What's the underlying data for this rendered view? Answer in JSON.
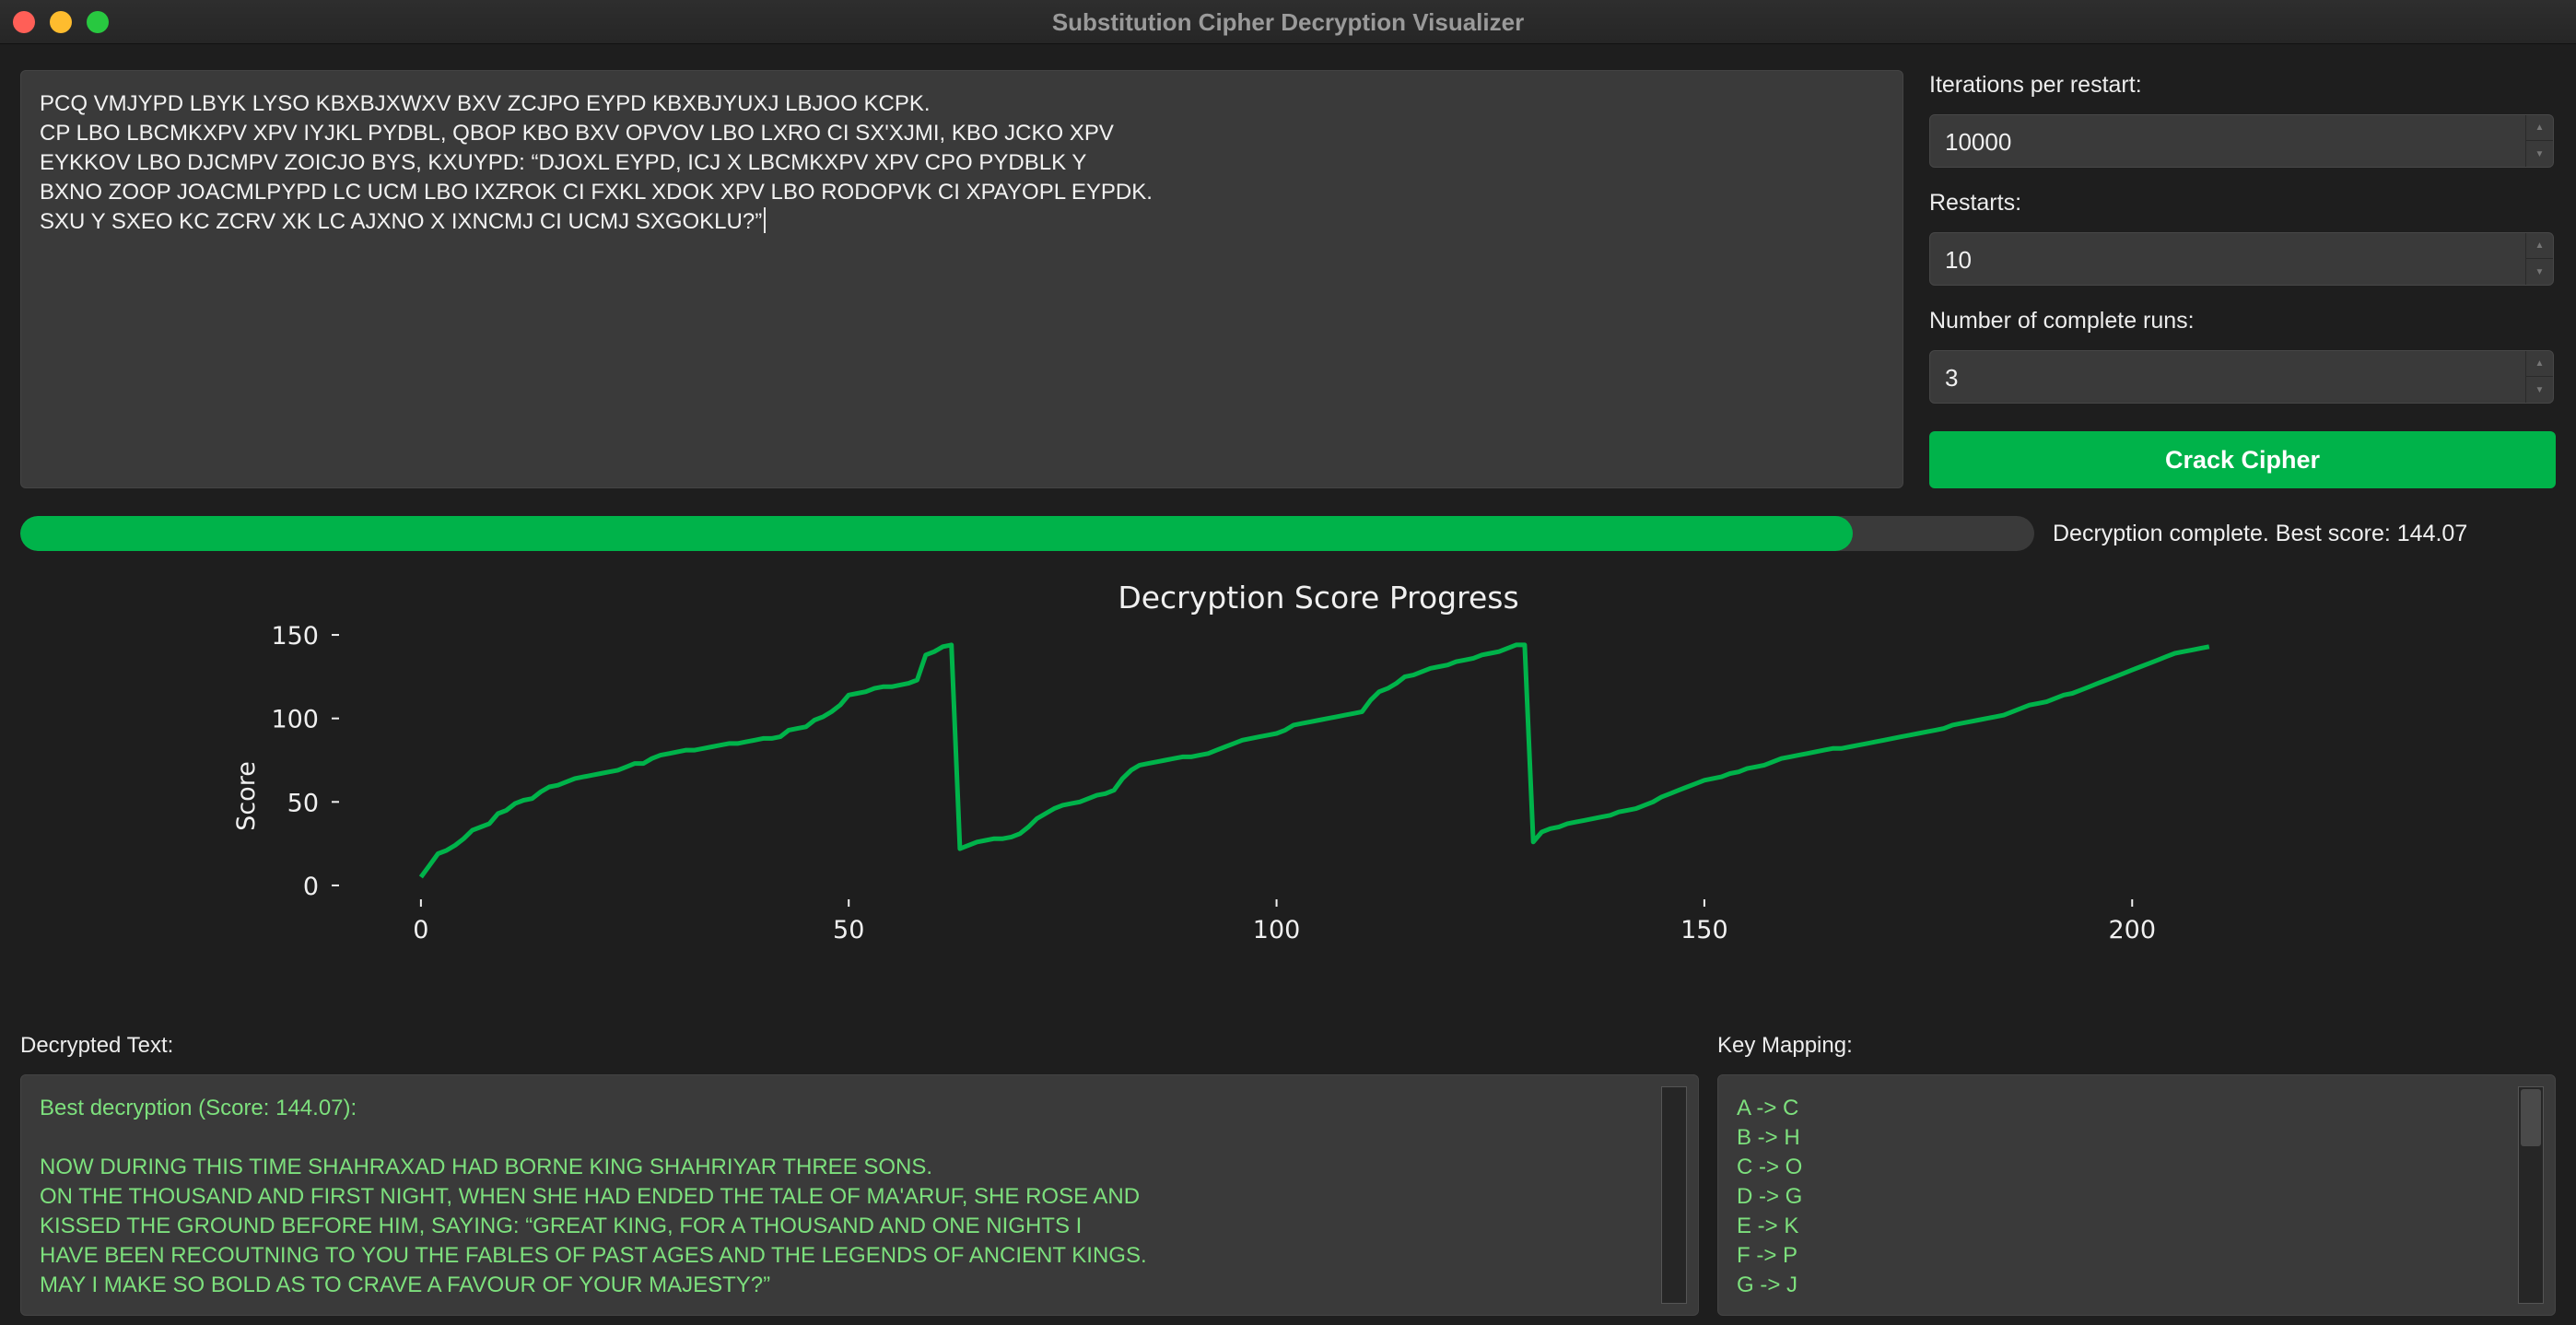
{
  "window": {
    "title": "Substitution Cipher Decryption Visualizer"
  },
  "cipher_input": {
    "lines": [
      "PCQ VMJYPD LBYK LYSO KBXBJXWXV BXV ZCJPO EYPD KBXBJYUXJ LBJOO KCPK.",
      "CP LBO LBCMKXPV XPV IYJKL PYDBL, QBOP KBO BXV OPVOV LBO LXRO CI SX'XJMI, KBO JCKO XPV",
      "EYKKOV LBO DJCMPV ZOICJO BYS, KXUYPD: “DJOXL EYPD, ICJ X LBCMKXPV XPV CPO PYDBLK Y",
      "BXNO ZOOP JOACMLPYPD LC UCM LBO IXZROK CI FXKL XDOK XPV LBO RODOPVK CI XPAYOPL EYPDK.",
      "SXU Y SXEO KC ZCRV XK LC AJXNO X IXNCMJ CI UCMJ SXGOKLU?”"
    ]
  },
  "settings": {
    "iterations_label": "Iterations per restart:",
    "iterations_value": "10000",
    "restarts_label": "Restarts:",
    "restarts_value": "10",
    "runs_label": "Number of complete runs:",
    "runs_value": "3",
    "crack_button": "Crack Cipher"
  },
  "progress": {
    "fraction": 0.91,
    "status": "Decryption complete. Best score: 144.07"
  },
  "colors": {
    "accent": "#00b34a",
    "decrypted_text": "#7de07d"
  },
  "chart_data": {
    "type": "line",
    "title": "Decryption Score Progress",
    "xlabel": "",
    "ylabel": "Score",
    "xlim": [
      -10,
      220
    ],
    "ylim": [
      -5,
      155
    ],
    "x_ticks": [
      0,
      50,
      100,
      150,
      200
    ],
    "y_ticks": [
      0,
      50,
      100,
      150
    ],
    "grid": false,
    "series": [
      {
        "color": "#00b34a",
        "points": [
          [
            0,
            5
          ],
          [
            1,
            12
          ],
          [
            2,
            19
          ],
          [
            3,
            21
          ],
          [
            4,
            24
          ],
          [
            5,
            28
          ],
          [
            6,
            33
          ],
          [
            7,
            35
          ],
          [
            8,
            37
          ],
          [
            9,
            43
          ],
          [
            10,
            45
          ],
          [
            11,
            49
          ],
          [
            12,
            51
          ],
          [
            13,
            52
          ],
          [
            14,
            56
          ],
          [
            15,
            59
          ],
          [
            16,
            60
          ],
          [
            17,
            62
          ],
          [
            18,
            64
          ],
          [
            19,
            65
          ],
          [
            20,
            66
          ],
          [
            21,
            67
          ],
          [
            22,
            68
          ],
          [
            23,
            69
          ],
          [
            24,
            71
          ],
          [
            25,
            73
          ],
          [
            26,
            73
          ],
          [
            27,
            76
          ],
          [
            28,
            78
          ],
          [
            29,
            79
          ],
          [
            30,
            80
          ],
          [
            31,
            81
          ],
          [
            32,
            81
          ],
          [
            33,
            82
          ],
          [
            34,
            83
          ],
          [
            35,
            84
          ],
          [
            36,
            85
          ],
          [
            37,
            85
          ],
          [
            38,
            86
          ],
          [
            39,
            87
          ],
          [
            40,
            88
          ],
          [
            41,
            88
          ],
          [
            42,
            89
          ],
          [
            43,
            93
          ],
          [
            44,
            94
          ],
          [
            45,
            95
          ],
          [
            46,
            99
          ],
          [
            47,
            101
          ],
          [
            48,
            104
          ],
          [
            49,
            108
          ],
          [
            50,
            114
          ],
          [
            51,
            115
          ],
          [
            52,
            116
          ],
          [
            53,
            118
          ],
          [
            54,
            119
          ],
          [
            55,
            119
          ],
          [
            56,
            120
          ],
          [
            57,
            121
          ],
          [
            58,
            123
          ],
          [
            59,
            138
          ],
          [
            60,
            140
          ],
          [
            61,
            143
          ],
          [
            62,
            144
          ],
          [
            63,
            22
          ],
          [
            64,
            24
          ],
          [
            65,
            26
          ],
          [
            66,
            27
          ],
          [
            67,
            28
          ],
          [
            68,
            28
          ],
          [
            69,
            29
          ],
          [
            70,
            31
          ],
          [
            71,
            35
          ],
          [
            72,
            40
          ],
          [
            73,
            43
          ],
          [
            74,
            46
          ],
          [
            75,
            48
          ],
          [
            76,
            49
          ],
          [
            77,
            50
          ],
          [
            78,
            52
          ],
          [
            79,
            54
          ],
          [
            80,
            55
          ],
          [
            81,
            57
          ],
          [
            82,
            64
          ],
          [
            83,
            69
          ],
          [
            84,
            72
          ],
          [
            85,
            73
          ],
          [
            86,
            74
          ],
          [
            87,
            75
          ],
          [
            88,
            76
          ],
          [
            89,
            77
          ],
          [
            90,
            77
          ],
          [
            91,
            78
          ],
          [
            92,
            79
          ],
          [
            93,
            81
          ],
          [
            94,
            83
          ],
          [
            95,
            85
          ],
          [
            96,
            87
          ],
          [
            97,
            88
          ],
          [
            98,
            89
          ],
          [
            99,
            90
          ],
          [
            100,
            91
          ],
          [
            101,
            93
          ],
          [
            102,
            96
          ],
          [
            103,
            97
          ],
          [
            104,
            98
          ],
          [
            105,
            99
          ],
          [
            106,
            100
          ],
          [
            107,
            101
          ],
          [
            108,
            102
          ],
          [
            109,
            103
          ],
          [
            110,
            104
          ],
          [
            111,
            111
          ],
          [
            112,
            116
          ],
          [
            113,
            118
          ],
          [
            114,
            121
          ],
          [
            115,
            125
          ],
          [
            116,
            126
          ],
          [
            117,
            128
          ],
          [
            118,
            130
          ],
          [
            119,
            131
          ],
          [
            120,
            132
          ],
          [
            121,
            134
          ],
          [
            122,
            135
          ],
          [
            123,
            136
          ],
          [
            124,
            138
          ],
          [
            125,
            139
          ],
          [
            126,
            140
          ],
          [
            127,
            142
          ],
          [
            128,
            144
          ],
          [
            129,
            144
          ],
          [
            130,
            26
          ],
          [
            131,
            32
          ],
          [
            132,
            34
          ],
          [
            133,
            35
          ],
          [
            134,
            37
          ],
          [
            135,
            38
          ],
          [
            136,
            39
          ],
          [
            137,
            40
          ],
          [
            138,
            41
          ],
          [
            139,
            42
          ],
          [
            140,
            44
          ],
          [
            141,
            45
          ],
          [
            142,
            46
          ],
          [
            143,
            48
          ],
          [
            144,
            50
          ],
          [
            145,
            53
          ],
          [
            146,
            55
          ],
          [
            147,
            57
          ],
          [
            148,
            59
          ],
          [
            149,
            61
          ],
          [
            150,
            63
          ],
          [
            151,
            64
          ],
          [
            152,
            65
          ],
          [
            153,
            67
          ],
          [
            154,
            68
          ],
          [
            155,
            70
          ],
          [
            156,
            71
          ],
          [
            157,
            72
          ],
          [
            158,
            74
          ],
          [
            159,
            76
          ],
          [
            160,
            77
          ],
          [
            161,
            78
          ],
          [
            162,
            79
          ],
          [
            163,
            80
          ],
          [
            164,
            81
          ],
          [
            165,
            82
          ],
          [
            166,
            82
          ],
          [
            167,
            83
          ],
          [
            168,
            84
          ],
          [
            169,
            85
          ],
          [
            170,
            86
          ],
          [
            171,
            87
          ],
          [
            172,
            88
          ],
          [
            173,
            89
          ],
          [
            174,
            90
          ],
          [
            175,
            91
          ],
          [
            176,
            92
          ],
          [
            177,
            93
          ],
          [
            178,
            94
          ],
          [
            179,
            96
          ],
          [
            180,
            97
          ],
          [
            181,
            98
          ],
          [
            182,
            99
          ],
          [
            183,
            100
          ],
          [
            184,
            101
          ],
          [
            185,
            102
          ],
          [
            186,
            104
          ],
          [
            187,
            106
          ],
          [
            188,
            108
          ],
          [
            189,
            109
          ],
          [
            190,
            110
          ],
          [
            191,
            112
          ],
          [
            192,
            114
          ],
          [
            193,
            115
          ],
          [
            194,
            117
          ],
          [
            195,
            119
          ],
          [
            196,
            121
          ],
          [
            197,
            123
          ],
          [
            198,
            125
          ],
          [
            199,
            127
          ],
          [
            200,
            129
          ],
          [
            201,
            131
          ],
          [
            202,
            133
          ],
          [
            203,
            135
          ],
          [
            204,
            137
          ],
          [
            205,
            139
          ],
          [
            206,
            140
          ],
          [
            207,
            141
          ],
          [
            208,
            142
          ],
          [
            209,
            143
          ]
        ]
      }
    ]
  },
  "decrypted": {
    "label": "Decrypted Text:",
    "lines": [
      "Best decryption (Score: 144.07):",
      "",
      "NOW DURING THIS TIME SHAHRAXAD HAD BORNE KING SHAHRIYAR THREE SONS.",
      "ON THE THOUSAND AND FIRST NIGHT, WHEN SHE HAD ENDED THE TALE OF MA'ARUF, SHE ROSE AND",
      "KISSED THE GROUND BEFORE HIM, SAYING: “GREAT KING, FOR A THOUSAND AND ONE NIGHTS I",
      "HAVE BEEN RECOUTNING TO YOU THE FABLES OF PAST AGES AND THE LEGENDS OF ANCIENT KINGS.",
      "MAY I MAKE SO BOLD AS TO CRAVE A FAVOUR OF YOUR MAJESTY?”"
    ]
  },
  "key_mapping": {
    "label": "Key Mapping:",
    "lines": [
      "A -> C",
      "B -> H",
      "C -> O",
      "D -> G",
      "E -> K",
      "F -> P",
      "G -> J"
    ]
  }
}
